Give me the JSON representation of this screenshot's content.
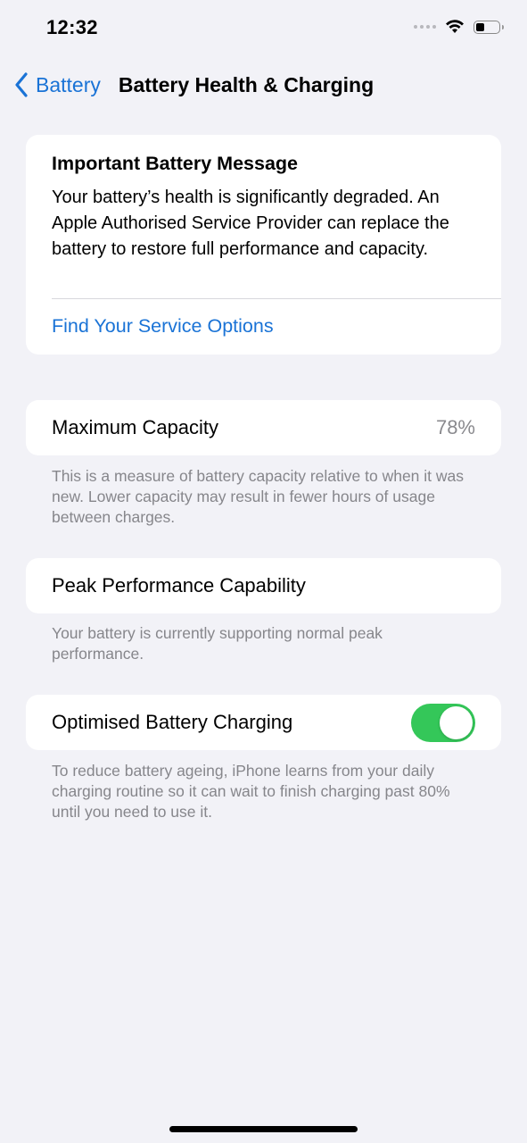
{
  "status_bar": {
    "time": "12:32",
    "icons": [
      "signal-dots-icon",
      "wifi-icon",
      "battery-icon"
    ],
    "battery_level": 0.3
  },
  "nav": {
    "back_label": "Battery",
    "title": "Battery Health & Charging"
  },
  "message_card": {
    "title": "Important Battery Message",
    "body": "Your battery’s health is significantly degraded. An Apple Authorised Service Provider can replace the battery to restore full performance and capacity.",
    "link": "Find Your Service Options"
  },
  "max_capacity": {
    "label": "Maximum Capacity",
    "value": "78%",
    "footer": "This is a measure of battery capacity relative to when it was new. Lower capacity may result in fewer hours of usage between charges."
  },
  "peak_performance": {
    "label": "Peak Performance Capability",
    "footer": "Your battery is currently supporting normal peak performance."
  },
  "optimised_charging": {
    "label": "Optimised Battery Charging",
    "enabled": true,
    "footer": "To reduce battery ageing, iPhone learns from your daily charging routine so it can wait to finish charging past 80% until you need to use it."
  },
  "colors": {
    "accent": "#1a73d6",
    "toggle_on": "#34c759",
    "background": "#f2f2f7",
    "secondary_text": "#86868b"
  }
}
